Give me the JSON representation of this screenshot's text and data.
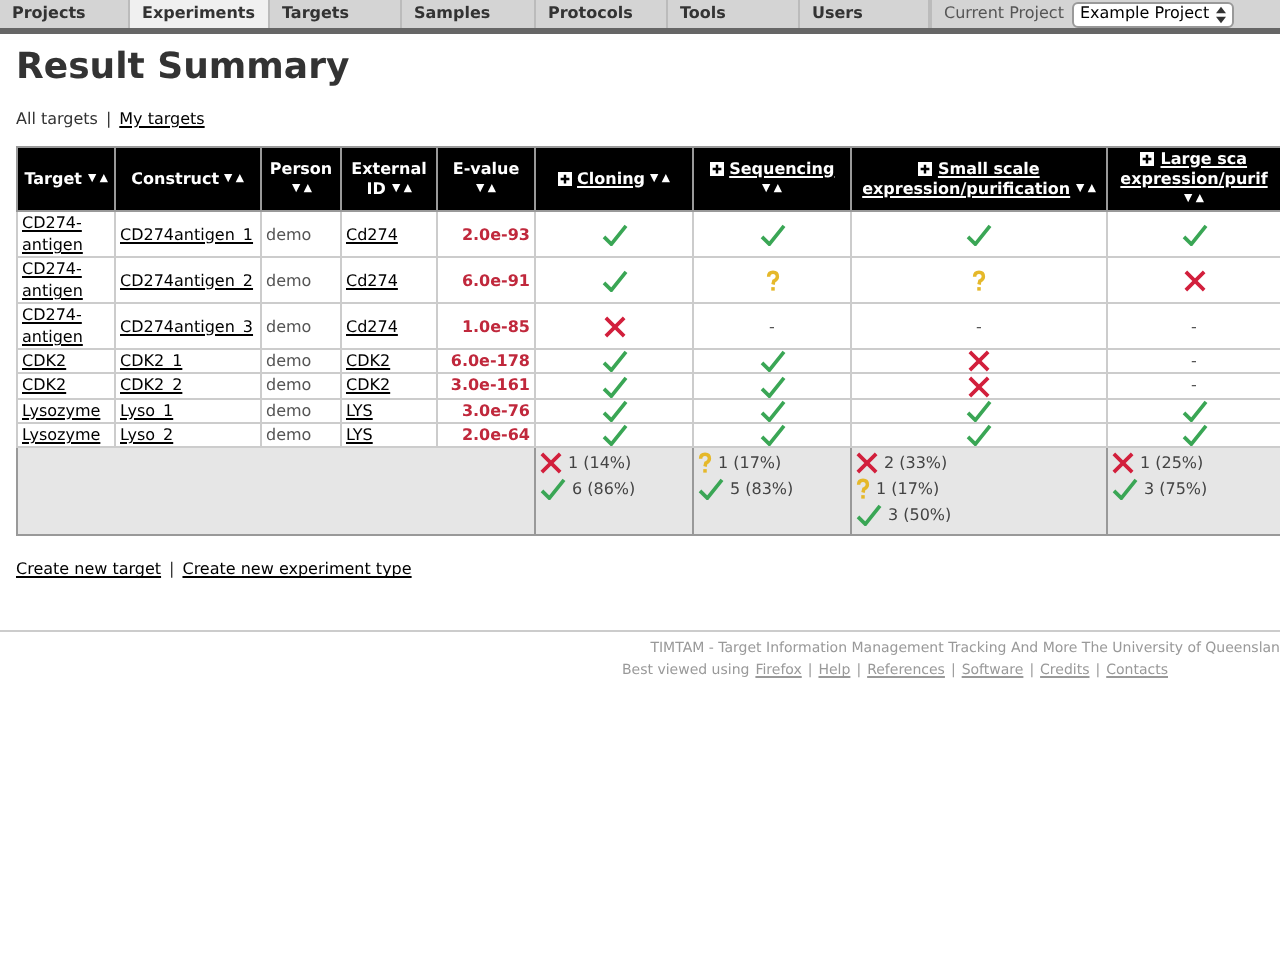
{
  "nav": {
    "tabs": [
      {
        "label": "Projects",
        "selected": false
      },
      {
        "label": "Experiments",
        "selected": true
      },
      {
        "label": "Targets",
        "selected": false
      },
      {
        "label": "Samples",
        "selected": false
      },
      {
        "label": "Protocols",
        "selected": false
      },
      {
        "label": "Tools",
        "selected": false
      },
      {
        "label": "Users",
        "selected": false
      }
    ],
    "current_project_label": "Current Project",
    "current_project": "Example Project"
  },
  "title": "Result Summary",
  "separator": "|",
  "filters": [
    {
      "label": "All targets",
      "selected": true
    },
    {
      "label": "My targets",
      "selected": false
    }
  ],
  "table": {
    "columns": [
      {
        "label": "Target",
        "kind": "field"
      },
      {
        "label": "Construct",
        "kind": "field"
      },
      {
        "label": "Person",
        "kind": "field"
      },
      {
        "label": "External ID",
        "kind": "field"
      },
      {
        "label": "E-value",
        "kind": "field"
      },
      {
        "label": "Cloning",
        "kind": "experiment"
      },
      {
        "label": "Sequencing",
        "kind": "experiment"
      },
      {
        "label": "Small scale expression/purification",
        "kind": "experiment"
      },
      {
        "label": "Large sca expression/purif",
        "kind": "experiment"
      }
    ],
    "rows": [
      {
        "target": "CD274-antigen",
        "construct": "CD274antigen_1",
        "person": "demo",
        "external_id": "Cd274",
        "evalue": "2.0e-93",
        "results": [
          {
            "kind": "pass"
          },
          {
            "kind": "pass"
          },
          {
            "kind": "pass"
          },
          {
            "kind": "pass"
          }
        ]
      },
      {
        "target": "CD274-antigen",
        "construct": "CD274antigen_2",
        "person": "demo",
        "external_id": "Cd274",
        "evalue": "6.0e-91",
        "results": [
          {
            "kind": "pass"
          },
          {
            "kind": "unknown"
          },
          {
            "kind": "unknown"
          },
          {
            "kind": "fail"
          }
        ]
      },
      {
        "target": "CD274-antigen",
        "construct": "CD274antigen_3",
        "person": "demo",
        "external_id": "Cd274",
        "evalue": "1.0e-85",
        "results": [
          {
            "kind": "fail"
          },
          {
            "kind": "none",
            "text": "-"
          },
          {
            "kind": "none",
            "text": "-"
          },
          {
            "kind": "none",
            "text": "-"
          }
        ]
      },
      {
        "target": "CDK2",
        "construct": "CDK2_1",
        "person": "demo",
        "external_id": "CDK2",
        "evalue": "6.0e-178",
        "results": [
          {
            "kind": "pass"
          },
          {
            "kind": "pass"
          },
          {
            "kind": "fail"
          },
          {
            "kind": "none",
            "text": "-"
          }
        ]
      },
      {
        "target": "CDK2",
        "construct": "CDK2_2",
        "person": "demo",
        "external_id": "CDK2",
        "evalue": "3.0e-161",
        "results": [
          {
            "kind": "pass"
          },
          {
            "kind": "pass"
          },
          {
            "kind": "fail"
          },
          {
            "kind": "none",
            "text": "-"
          }
        ]
      },
      {
        "target": "Lysozyme",
        "construct": "Lyso_1",
        "person": "demo",
        "external_id": "LYS",
        "evalue": "3.0e-76",
        "results": [
          {
            "kind": "pass"
          },
          {
            "kind": "pass"
          },
          {
            "kind": "pass"
          },
          {
            "kind": "pass"
          }
        ]
      },
      {
        "target": "Lysozyme",
        "construct": "Lyso_2",
        "person": "demo",
        "external_id": "LYS",
        "evalue": "2.0e-64",
        "results": [
          {
            "kind": "pass"
          },
          {
            "kind": "pass"
          },
          {
            "kind": "pass"
          },
          {
            "kind": "pass"
          }
        ]
      }
    ],
    "summary": [
      [
        {
          "kind": "fail",
          "text": "1 (14%)"
        },
        {
          "kind": "pass",
          "text": "6 (86%)"
        }
      ],
      [
        {
          "kind": "unknown",
          "text": "1 (17%)"
        },
        {
          "kind": "pass",
          "text": "5 (83%)"
        }
      ],
      [
        {
          "kind": "fail",
          "text": "2 (33%)"
        },
        {
          "kind": "unknown",
          "text": "1 (17%)"
        },
        {
          "kind": "pass",
          "text": "3 (50%)"
        }
      ],
      [
        {
          "kind": "fail",
          "text": "1 (25%)"
        },
        {
          "kind": "pass",
          "text": "3 (75%)"
        }
      ]
    ]
  },
  "actions": [
    "Create new target",
    "Create new experiment type"
  ],
  "footer": {
    "line": "TIMTAM - Target Information Management Tracking And More   The University of Queenslan",
    "prefix": "Best viewed using",
    "links": [
      "Firefox",
      "Help",
      "References",
      "Software",
      "Credits",
      "Contacts"
    ]
  }
}
